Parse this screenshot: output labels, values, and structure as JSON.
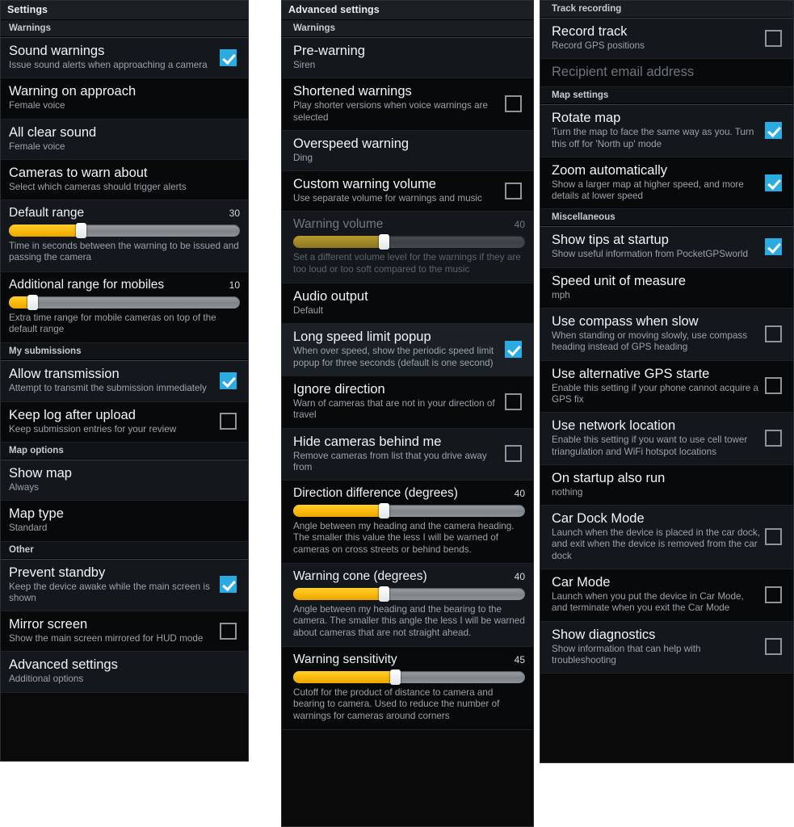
{
  "theme": {
    "accent_checked": "#2aabe2",
    "slider_fill": "#f9b60a",
    "slider_fill_disabled": "#9c8524",
    "background": "#07090b",
    "text_primary": "#f2f5f7",
    "text_secondary": "#9aa2a9"
  },
  "panel1": {
    "titlebar": "Settings",
    "sections": [
      {
        "header": "Warnings",
        "items": [
          {
            "title": "Sound warnings",
            "summary": "Issue sound alerts when approaching a camera",
            "checkbox": "checked"
          },
          {
            "title": "Warning on approach",
            "summary": "Female voice"
          },
          {
            "title": "All clear sound",
            "summary": "Female voice"
          },
          {
            "title": "Cameras to warn about",
            "summary": "Select which cameras should trigger alerts"
          },
          {
            "title": "Default range",
            "value": "30",
            "percent": 31,
            "summary": "Time in seconds between the warning to be issued and passing the camera",
            "type": "slider"
          },
          {
            "title": "Additional range for mobiles",
            "value": "10",
            "percent": 10,
            "summary": "Extra time range for mobile cameras on top of the default range",
            "type": "slider"
          }
        ]
      },
      {
        "header": "My submissions",
        "items": [
          {
            "title": "Allow transmission",
            "summary": "Attempt to transmit the submission immediately",
            "checkbox": "checked"
          },
          {
            "title": "Keep log after upload",
            "summary": "Keep submission entries for your review",
            "checkbox": "unchecked"
          }
        ]
      },
      {
        "header": "Map options",
        "items": [
          {
            "title": "Show map",
            "summary": "Always"
          },
          {
            "title": "Map type",
            "summary": "Standard"
          }
        ]
      },
      {
        "header": "Other",
        "items": [
          {
            "title": "Prevent standby",
            "summary": "Keep the device awake while the main screen is shown",
            "checkbox": "checked"
          },
          {
            "title": "Mirror screen",
            "summary": "Show the main screen mirrored for HUD mode",
            "checkbox": "unchecked"
          },
          {
            "title": "Advanced settings",
            "summary": "Additional options"
          }
        ]
      }
    ]
  },
  "panel2": {
    "titlebar": "Advanced settings",
    "sections": [
      {
        "header": "Warnings",
        "items": [
          {
            "title": "Pre-warning",
            "summary": "Siren"
          },
          {
            "title": "Shortened warnings",
            "summary": "Play shorter versions when voice warnings are selected",
            "checkbox": "unchecked"
          },
          {
            "title": "Overspeed warning",
            "summary": "Ding"
          },
          {
            "title": "Custom warning volume",
            "summary": "Use separate volume for warnings and music",
            "checkbox": "unchecked"
          },
          {
            "title": "Warning volume",
            "value": "40",
            "percent": 39,
            "summary": "Set a different volume level for the warnings if they are too loud or too soft compared to the music",
            "type": "slider",
            "state": "disabled"
          },
          {
            "title": "Audio output",
            "summary": "Default"
          },
          {
            "title": "Long speed limit popup",
            "summary": "When over speed, show the periodic speed limit popup for three seconds (default is one second)",
            "checkbox": "checked",
            "state": "highlighted"
          },
          {
            "title": "Ignore direction",
            "summary": "Warn of cameras that are not in your direction of travel",
            "checkbox": "unchecked"
          },
          {
            "title": "Hide cameras behind me",
            "summary": "Remove cameras from list that you drive away from",
            "checkbox": "unchecked"
          },
          {
            "title": "Direction difference (degrees)",
            "value": "40",
            "percent": 39,
            "summary": "Angle between my heading and the camera heading. The smaller this value the less I will be warned of cameras on cross streets or behind bends.",
            "type": "slider"
          },
          {
            "title": "Warning cone (degrees)",
            "value": "40",
            "percent": 39,
            "summary": "Angle between my heading and the bearing to the camera. The smaller this angle the less I will be warned about cameras that are not straight ahead.",
            "type": "slider"
          },
          {
            "title": "Warning sensitivity",
            "value": "45",
            "percent": 44,
            "summary": "Cutoff for the product of distance to camera and bearing to camera. Used to reduce the number of warnings for cameras around corners",
            "type": "slider"
          }
        ]
      }
    ]
  },
  "panel3": {
    "sections": [
      {
        "header": "Track recording",
        "items": [
          {
            "title": "Record track",
            "summary": "Record GPS positions",
            "checkbox": "unchecked"
          },
          {
            "title": "Recipient email address",
            "state": "disabled"
          }
        ]
      },
      {
        "header": "Map settings",
        "items": [
          {
            "title": "Rotate map",
            "summary": "Turn the map to face the same way as you. Turn this off for 'North up' mode",
            "checkbox": "checked"
          },
          {
            "title": "Zoom automatically",
            "summary": "Show a larger map at higher speed, and more details at lower speed",
            "checkbox": "checked"
          }
        ]
      },
      {
        "header": "Miscellaneous",
        "items": [
          {
            "title": "Show tips at startup",
            "summary": "Show useful information from PocketGPSworld",
            "checkbox": "checked"
          },
          {
            "title": "Speed unit of measure",
            "summary": "mph"
          },
          {
            "title": "Use compass when slow",
            "summary": "When standing or moving slowly, use compass heading instead of GPS heading",
            "checkbox": "unchecked"
          },
          {
            "title": "Use alternative GPS starte",
            "summary": "Enable this setting if your phone cannot acquire a GPS fix",
            "checkbox": "unchecked"
          },
          {
            "title": "Use network location",
            "summary": "Enable this setting if you want to use cell tower triangulation and WiFi hotspot locations",
            "checkbox": "unchecked"
          },
          {
            "title": "On startup also run",
            "summary": "nothing"
          },
          {
            "title": "Car Dock Mode",
            "summary": "Launch when the device is placed in the car dock, and exit when the device is removed from the car dock",
            "checkbox": "unchecked"
          },
          {
            "title": "Car Mode",
            "summary": "Launch when you put the device in Car Mode, and terminate when you exit the Car Mode",
            "checkbox": "unchecked"
          },
          {
            "title": "Show diagnostics",
            "summary": "Show information that can help with troubleshooting",
            "checkbox": "unchecked"
          }
        ]
      }
    ]
  }
}
